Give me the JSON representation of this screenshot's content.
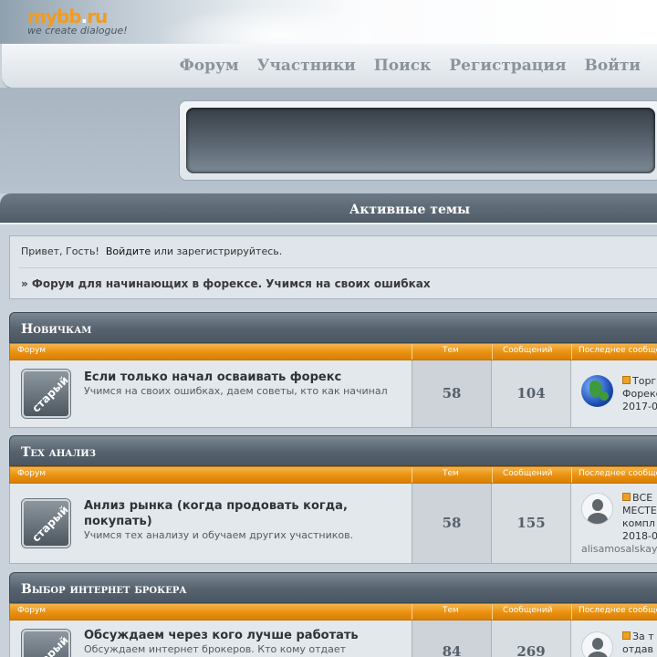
{
  "header": {
    "logo_brand": "mybb",
    "logo_dot": ".",
    "logo_suffix": "ru",
    "logo_tagline": "we create dialogue!"
  },
  "nav": {
    "items": [
      "Форум",
      "Участники",
      "Поиск",
      "Регистрация",
      "Войти"
    ]
  },
  "active_bar": {
    "title": "Активные темы"
  },
  "welcome": {
    "greeting": "Привет, Гость!",
    "login": "Войдите",
    "or": "или",
    "register": "зарегистрируйтесь.",
    "board_title": "» Форум для начинающих в форексе. Учимся на своих ошибках"
  },
  "columns": {
    "forum": "Форум",
    "topics": "Тем",
    "posts": "Сообщений",
    "last_post": "Последнее сообщение"
  },
  "categories": [
    {
      "name": "Новичкам",
      "forum": {
        "icon_label": "старый",
        "title": "Если только начал осваивать форекс",
        "description": "Учимся на своих ошибках, даем советы, кто как начинал",
        "topics": "58",
        "posts": "104",
        "last_line1": "Торг",
        "last_line2": "Форекс",
        "last_date": "2017-0"
      }
    },
    {
      "name": "Тех анализ",
      "forum": {
        "icon_label": "старый",
        "title_line1": "Анлиз рынка (когда продовать когда,",
        "title_line2": "покупать)",
        "description": "Учимся тех анализу и обучаем других участников.",
        "topics": "58",
        "posts": "155",
        "last_line1": "ВСЕ",
        "last_line2": "МЕСТЕ",
        "last_line3": "компл",
        "last_date": "2018-0",
        "last_author": "alisamosalskay"
      }
    },
    {
      "name": "Выбор интернет брокера",
      "forum": {
        "icon_label": "старый",
        "title": "Обсуждаем через кого лучше работать",
        "description": "Обсуждаем интернет брокеров. Кто кому отдает",
        "topics": "84",
        "posts": "269",
        "last_line1": "За т",
        "last_line2": "отдав"
      }
    }
  ]
}
